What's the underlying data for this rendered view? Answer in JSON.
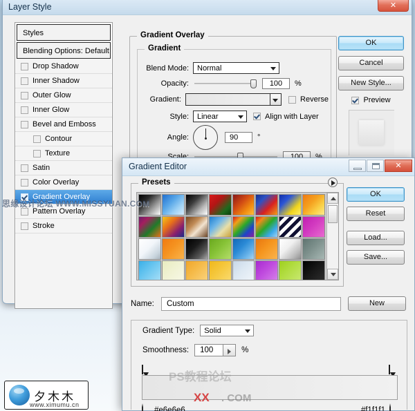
{
  "layer_style": {
    "title": "Layer Style",
    "close_glyph": "✕",
    "styles_panel": {
      "header": "Styles",
      "blending_options": "Blending Options: Default",
      "items": [
        {
          "label": "Drop Shadow",
          "checked": false,
          "indent": false,
          "selected": false
        },
        {
          "label": "Inner Shadow",
          "checked": false,
          "indent": false,
          "selected": false
        },
        {
          "label": "Outer Glow",
          "checked": false,
          "indent": false,
          "selected": false
        },
        {
          "label": "Inner Glow",
          "checked": false,
          "indent": false,
          "selected": false
        },
        {
          "label": "Bevel and Emboss",
          "checked": false,
          "indent": false,
          "selected": false
        },
        {
          "label": "Contour",
          "checked": false,
          "indent": true,
          "selected": false
        },
        {
          "label": "Texture",
          "checked": false,
          "indent": true,
          "selected": false
        },
        {
          "label": "Satin",
          "checked": false,
          "indent": false,
          "selected": false
        },
        {
          "label": "Color Overlay",
          "checked": false,
          "indent": false,
          "selected": false
        },
        {
          "label": "Gradient Overlay",
          "checked": true,
          "indent": false,
          "selected": true
        },
        {
          "label": "Pattern Overlay",
          "checked": false,
          "indent": false,
          "selected": false
        },
        {
          "label": "Stroke",
          "checked": false,
          "indent": false,
          "selected": false
        }
      ]
    },
    "gradient_overlay": {
      "group_title": "Gradient Overlay",
      "sub_title": "Gradient",
      "blend_mode_label": "Blend Mode:",
      "blend_mode_value": "Normal",
      "opacity_label": "Opacity:",
      "opacity_value": "100",
      "opacity_unit": "%",
      "gradient_label": "Gradient:",
      "reverse_label": "Reverse",
      "reverse_checked": false,
      "style_label": "Style:",
      "style_value": "Linear",
      "align_label": "Align with Layer",
      "align_checked": true,
      "angle_label": "Angle:",
      "angle_value": "90",
      "angle_unit": "°",
      "scale_label": "Scale:",
      "scale_value": "100",
      "scale_unit": "%",
      "gradient_start_color": "#e6e6e6",
      "gradient_end_color": "#f1f1f1"
    },
    "buttons": {
      "ok": "OK",
      "cancel": "Cancel",
      "new_style": "New Style...",
      "preview": "Preview",
      "preview_checked": true
    }
  },
  "gradient_editor": {
    "title": "Gradient Editor",
    "minimize_glyph": "",
    "maximize_glyph": "",
    "close_glyph": "✕",
    "presets": {
      "caption": "Presets",
      "menu_icon": "presets-menu-icon",
      "swatches": [
        {
          "css": "linear-gradient(135deg,#000000 0%,#2a2a2a 30%,#9a9a9a 65%,#ffffff 100%)"
        },
        {
          "css": "linear-gradient(135deg,#1f6fd0 0%,#5aa8e8 40%,#9fd2f5 70%,#d8ecfb 100%)"
        },
        {
          "css": "linear-gradient(135deg,#000000 0%,#3b3b3b 35%,#b6b6b6 70%,#ffffff 100%)"
        },
        {
          "css": "linear-gradient(135deg,#d81b1b 0%,#b41515 35%,#1d6a1d 75%,#0c3f0c 100%)"
        },
        {
          "css": "linear-gradient(135deg,#8a1818 0%,#d24b14 40%,#f08a10 70%,#ffc03a 100%)"
        },
        {
          "css": "linear-gradient(135deg,#17308f 0%,#2d52c4 28%,#d82020 62%,#f0a01a 100%)"
        },
        {
          "css": "linear-gradient(135deg,#1230a8 0%,#2b55d6 30%,#f0d41c 70%,#fff06a 100%)"
        },
        {
          "css": "linear-gradient(135deg,#f07a12 0%,#f5a220 40%,#fad046 70%,#fdeb8e 100%)"
        },
        {
          "css": "linear-gradient(135deg,#6d1b6d 0%,#a31f5e 25%,#1f7a2a 60%,#e8701a 100%)"
        },
        {
          "css": "linear-gradient(135deg,#f5c61b 0%,#e8701a 35%,#8a1f6e 70%,#1b2a8a 100%)"
        },
        {
          "css": "linear-gradient(135deg,#7a4a22 0%,#c08a55 35%,#f2e3cf 60%,#6d4526 100%)"
        },
        {
          "css": "linear-gradient(135deg,#1e7fd0 0%,#6fb6e8 35%,#e8dfa8 65%,#c9a23a 100%)"
        },
        {
          "css": "linear-gradient(135deg,#d81b1b 0%,#f0a01a 22%,#2aa82a 48%,#1f44c8 72%,#8a1f9e 100%)"
        },
        {
          "css": "linear-gradient(135deg,#d81b1b 0%,#f08a1a 20%,#2aa82a 48%,#3aa8e8 75%,#9fd2f5 100%)"
        },
        {
          "css": "repeating-linear-gradient(135deg,#111133 0px,#111133 5px,#ffffff 5px,#ffffff 10px)"
        },
        {
          "css": "linear-gradient(135deg,#c01fb0 0%,#d23ac0 45%,#e86ad0 100%)"
        },
        {
          "css": "linear-gradient(135deg,#ffffff 0%,#f2f6fa 45%,#c8d4dd 80%,#a8b4bd 100%)"
        },
        {
          "css": "linear-gradient(135deg,#f07a12 0%,#f59320 45%,#fab34a 100%)"
        },
        {
          "css": "linear-gradient(135deg,#000000 0%,#1a1a1a 40%,#5a5a5a 75%,#a8a8a8 100%)"
        },
        {
          "css": "linear-gradient(135deg,#6aa81f 0%,#86c236 45%,#b4dd6a 100%)"
        },
        {
          "css": "linear-gradient(135deg,#1369b8 0%,#2a8ad6 40%,#6ab4ea 75%,#a8d4f2 100%)"
        },
        {
          "css": "linear-gradient(135deg,#e8760f 0%,#f5951e 45%,#fab44e 100%)"
        },
        {
          "css": "linear-gradient(135deg,#ffffff 0%,#f0f0f0 40%,#bdbdbd 75%,#8f8f8f 100%)"
        },
        {
          "css": "linear-gradient(135deg,#5f7470 0%,#7d908c 45%,#a8b8b4 100%)"
        },
        {
          "css": "linear-gradient(135deg,#3ab0e8 0%,#6ac6f0 45%,#a8dff7 100%)"
        },
        {
          "css": "linear-gradient(135deg,#e8ecc0 0%,#f0f2d2 45%,#f7f8e6 100%)"
        },
        {
          "css": "linear-gradient(135deg,#f0a62a 0%,#f5bb4a 45%,#fad37e 100%)"
        },
        {
          "css": "linear-gradient(135deg,#f0b81c 0%,#f5c73c 45%,#fadb70 100%)"
        },
        {
          "css": "linear-gradient(135deg,#c8d8e8 0%,#dde8f2 45%,#f0f5fa 100%)"
        },
        {
          "css": "linear-gradient(135deg,#a82ad0 0%,#bf4ade 45%,#d682ea 100%)"
        },
        {
          "css": "linear-gradient(135deg,#9fd01f 0%,#b2dd42 45%,#c9e872 100%)"
        },
        {
          "css": "linear-gradient(135deg,#000000 0%,#161616 45%,#2e2e2e 100%)"
        }
      ]
    },
    "buttons": {
      "ok": "OK",
      "reset": "Reset",
      "load": "Load...",
      "save": "Save...",
      "new": "New"
    },
    "name_label": "Name:",
    "name_value": "Custom",
    "gradient_type_label": "Gradient Type:",
    "gradient_type_value": "Solid",
    "smoothness_label": "Smoothness:",
    "smoothness_value": "100",
    "smoothness_unit": "%",
    "strip": {
      "start_color": "#e6e6e6",
      "end_color": "#f1f1f1",
      "start_label": "#e6e6e6",
      "end_label": "#f1f1f1"
    }
  },
  "watermarks": {
    "missyuan": "思缘设计论坛  WWW.MISSYUAN.COM",
    "ps_forum": "PS教程论坛",
    "xx": "XX",
    "com": ". COM"
  },
  "logo": {
    "text": "夕木木",
    "url": "www.ximumu.cn"
  }
}
